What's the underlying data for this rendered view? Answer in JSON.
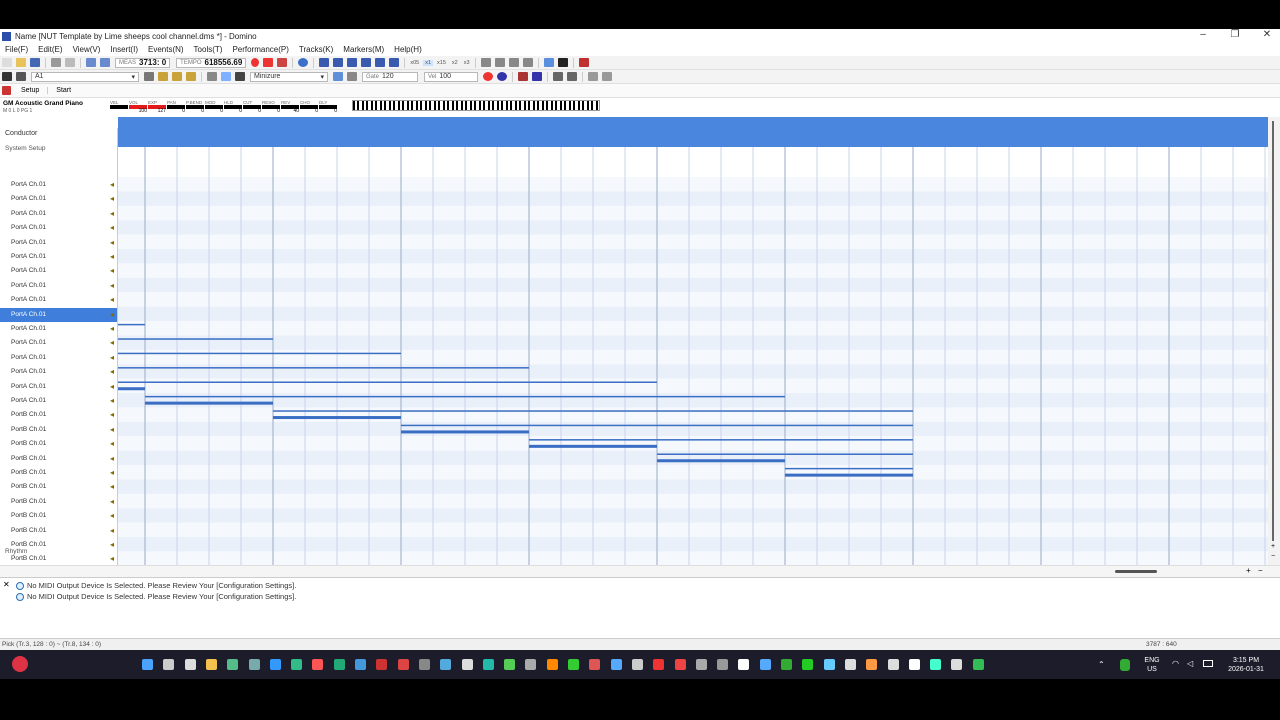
{
  "window": {
    "title": "Name [NUT Template by Lime sheeps cool channel.dms *] - Domino"
  },
  "menu": [
    "File(F)",
    "Edit(E)",
    "View(V)",
    "Insert(I)",
    "Events(N)",
    "Tools(T)",
    "Performance(P)",
    "Tracks(K)",
    "Markers(M)",
    "Help(H)"
  ],
  "toolbar": {
    "meas_label": "MEAS",
    "meas_value": "3713:  0",
    "tempo_label": "TEMPO",
    "tempo_value": "618556.69",
    "snap_labels": [
      "x05",
      "x1",
      "x15",
      "x2",
      "x3"
    ],
    "track_select": "A1",
    "grid_select": "Minizure",
    "gate_label": "Gate",
    "gate_value": "120",
    "vel_label": "Vel",
    "vel_value": "100"
  },
  "tabs": {
    "setup": "Setup",
    "start": "Start"
  },
  "instrument": {
    "name": "GM Acoustic Grand Piano",
    "sub": "M     0   L    0  PG    1",
    "controls": [
      {
        "label": "VEL",
        "value": "",
        "color": "#000000"
      },
      {
        "label": "VOL",
        "value": "100",
        "color": "#e21a1a"
      },
      {
        "label": "EXP",
        "value": "127",
        "color": "#e21a1a"
      },
      {
        "label": "PAN",
        "value": "0",
        "color": "#000000"
      },
      {
        "label": "P.BEND",
        "value": "0",
        "color": "#000000"
      },
      {
        "label": "MOD",
        "value": "0",
        "color": "#000000"
      },
      {
        "label": "HLD",
        "value": "0",
        "color": "#000000"
      },
      {
        "label": "CUT",
        "value": "0",
        "color": "#000000"
      },
      {
        "label": "RESO",
        "value": "0",
        "color": "#000000"
      },
      {
        "label": "REV",
        "value": "40",
        "color": "#000000"
      },
      {
        "label": "CHO",
        "value": "0",
        "color": "#000000"
      },
      {
        "label": "DLY",
        "value": "0",
        "color": "#000000"
      }
    ]
  },
  "tracks": {
    "conductor": "Conductor",
    "system_setup": "System Setup",
    "rhythm": "Rhythm",
    "rows": [
      "PortA  Ch.01",
      "PortA  Ch.01",
      "PortA  Ch.01",
      "PortA  Ch.01",
      "PortA  Ch.01",
      "PortA  Ch.01",
      "PortA  Ch.01",
      "PortA  Ch.01",
      "PortA  Ch.01",
      "PortA  Ch.01",
      "PortA  Ch.01",
      "PortA  Ch.01",
      "PortA  Ch.01",
      "PortA  Ch.01",
      "PortA  Ch.01",
      "PortA  Ch.01",
      "PortB  Ch.01",
      "PortB  Ch.01",
      "PortB  Ch.01",
      "PortB  Ch.01",
      "PortB  Ch.01",
      "PortB  Ch.01",
      "PortB  Ch.01",
      "PortB  Ch.01",
      "PortB  Ch.01",
      "PortB  Ch.01",
      "PortB  Ch.01",
      "PortB  Ch.01",
      "PortB  Ch.01"
    ],
    "selected_index": 9
  },
  "log": {
    "messages": [
      "No MIDI Output Device Is Selected. Please Review Your [Configuration Settings].",
      "No MIDI Output Device Is Selected. Please Review Your [Configuration Settings]."
    ]
  },
  "status": {
    "left": "Pick (Tr.3, 128 : 0) ~ (Tr.8, 134 : 0)",
    "right": "3787 : 640"
  },
  "taskbar": {
    "lang": "ENG",
    "region": "US",
    "time": "3:15 PM",
    "date": "2026-01-31"
  },
  "colors": {
    "accent": "#4a86dd",
    "selected_row": "#3f7fdb",
    "note": "#3a6ec4"
  }
}
